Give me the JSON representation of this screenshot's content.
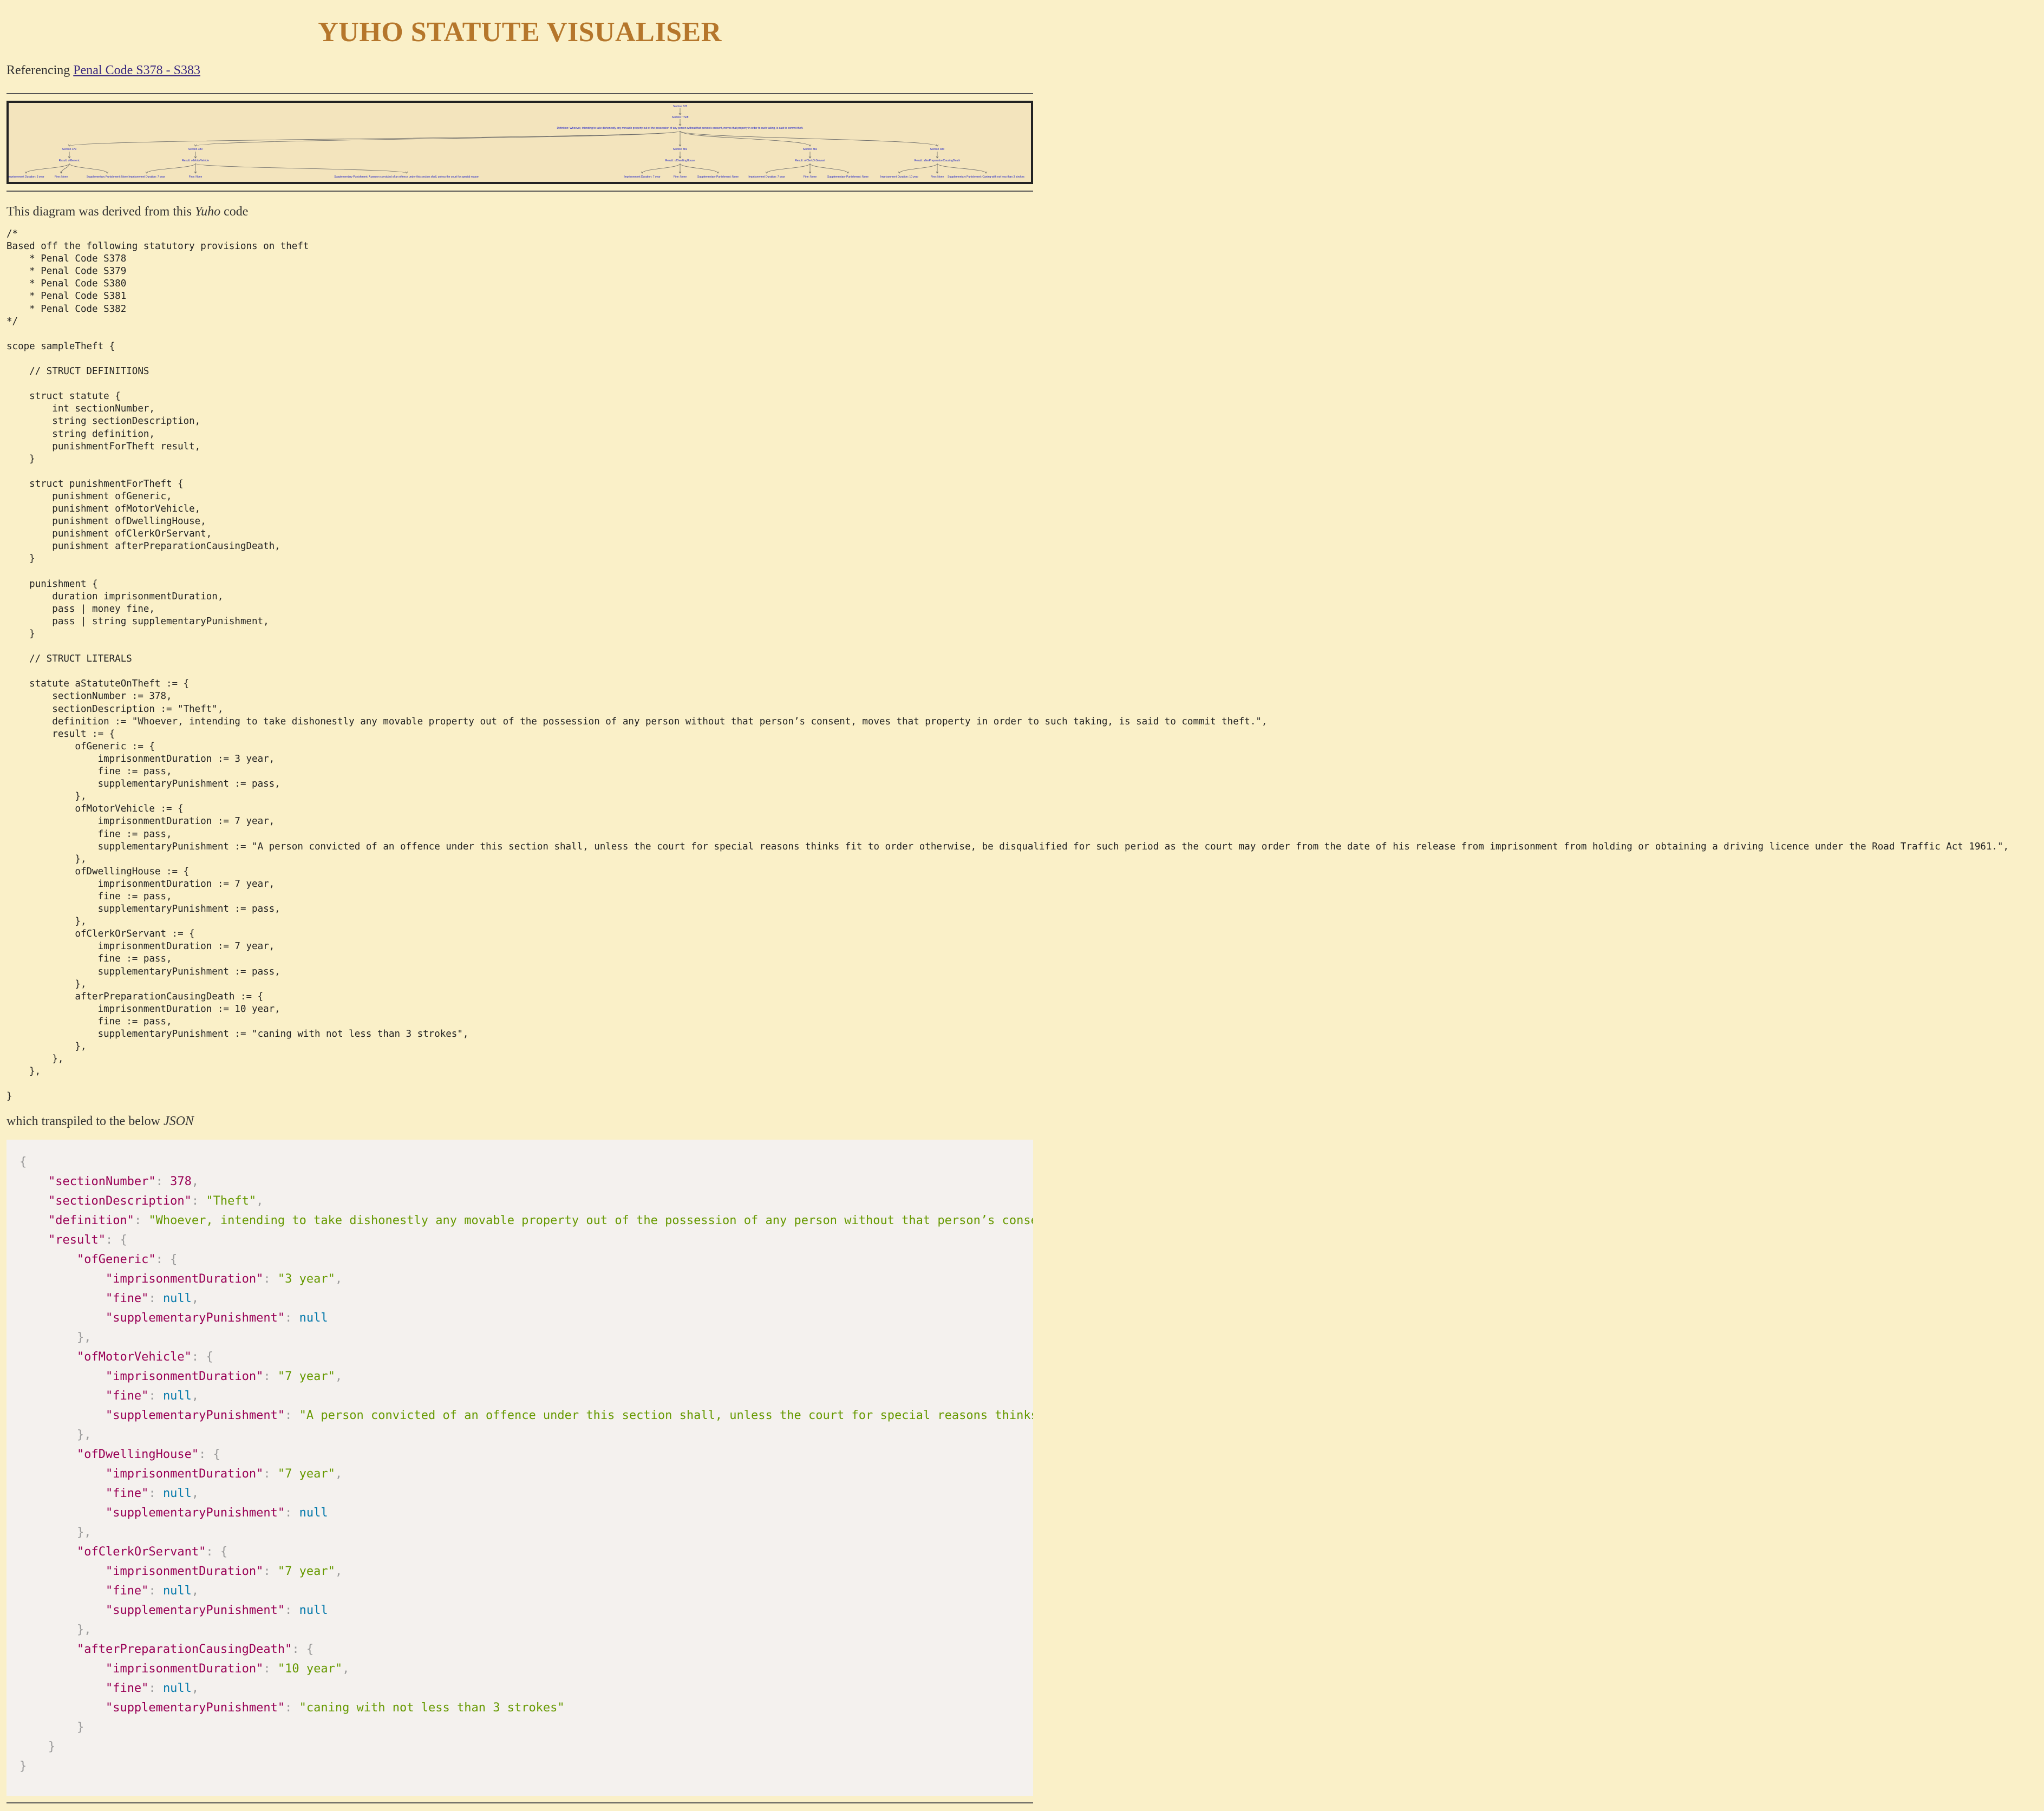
{
  "title": "YUHO STATUTE VISUALISER",
  "reference": {
    "prefix": "Referencing ",
    "link_text": "Penal Code S378 - S383"
  },
  "diagram": {
    "root": "Section 378",
    "description": "Section: Theft",
    "definition": "Definition: Whoever, intending to take dishonestly any movable property out of the possession of any person without that person's consent, moves that property in order to such taking, is said to commit theft.",
    "sections": [
      {
        "label": "Section 379",
        "group": "Result: ofGeneric",
        "leaves": [
          "Imprisonment Duration: 3 year",
          "Fine: None",
          "Supplementary Punishment: None"
        ]
      },
      {
        "label": "Section 380",
        "group": "Result: ofMotorVehicle",
        "leaves": [
          "Imprisonment Duration: 7 year",
          "Fine: None",
          "Supplementary Punishment: A person convicted of an offence under this section shall, unless the court for special reasons thinks fit to order otherwise, be disqualified for such period as the court may order from the date of his release from imprisonment from holding or obtaining a driving licence under the Road Traffic Act 1961."
        ]
      },
      {
        "label": "Section 381",
        "group": "Result: ofDwellingHouse",
        "leaves": [
          "Imprisonment Duration: 7 year",
          "Fine: None",
          "Supplementary Punishment: None"
        ]
      },
      {
        "label": "Section 382",
        "group": "Result: ofClerkOrServant",
        "leaves": [
          "Imprisonment Duration: 7 year",
          "Fine: None",
          "Supplementary Punishment: None"
        ]
      },
      {
        "label": "Section 383",
        "group": "Result: afterPreparationCausingDeath",
        "leaves": [
          "Imprisonment Duration: 10 year",
          "Fine: None",
          "Supplementary Punishment: Caning with not less than 3 strokes"
        ]
      }
    ]
  },
  "derived": {
    "prefix": "This diagram was derived from this ",
    "lang": "Yuho",
    "suffix": " code"
  },
  "yuho_code": "/*\nBased off the following statutory provisions on theft\n    * Penal Code S378\n    * Penal Code S379\n    * Penal Code S380\n    * Penal Code S381\n    * Penal Code S382\n*/\n\nscope sampleTheft {\n\n    // STRUCT DEFINITIONS\n\n    struct statute {\n        int sectionNumber,\n        string sectionDescription,\n        string definition,\n        punishmentForTheft result,\n    }\n\n    struct punishmentForTheft {\n        punishment ofGeneric,\n        punishment ofMotorVehicle,\n        punishment ofDwellingHouse,\n        punishment ofClerkOrServant,\n        punishment afterPreparationCausingDeath,\n    }\n\n    punishment {\n        duration imprisonmentDuration,\n        pass | money fine,\n        pass | string supplementaryPunishment,\n    }\n\n    // STRUCT LITERALS\n\n    statute aStatuteOnTheft := {\n        sectionNumber := 378,\n        sectionDescription := \"Theft\",\n        definition := \"Whoever, intending to take dishonestly any movable property out of the possession of any person without that person’s consent, moves that property in order to such taking, is said to commit theft.\",\n        result := {\n            ofGeneric := {\n                imprisonmentDuration := 3 year,\n                fine := pass,\n                supplementaryPunishment := pass,\n            },\n            ofMotorVehicle := {\n                imprisonmentDuration := 7 year,\n                fine := pass,\n                supplementaryPunishment := \"A person convicted of an offence under this section shall, unless the court for special reasons thinks fit to order otherwise, be disqualified for such period as the court may order from the date of his release from imprisonment from holding or obtaining a driving licence under the Road Traffic Act 1961.\",\n            },\n            ofDwellingHouse := {\n                imprisonmentDuration := 7 year,\n                fine := pass,\n                supplementaryPunishment := pass,\n            },\n            ofClerkOrServant := {\n                imprisonmentDuration := 7 year,\n                fine := pass,\n                supplementaryPunishment := pass,\n            },\n            afterPreparationCausingDeath := {\n                imprisonmentDuration := 10 year,\n                fine := pass,\n                supplementaryPunishment := \"caning with not less than 3 strokes\",\n            },\n        },\n    },\n\n}",
  "transpiled": {
    "prefix": "which transpiled to the below ",
    "lang": "JSON"
  },
  "json_output": {
    "sectionNumber": 378,
    "sectionDescription": "Theft",
    "definition": "Whoever, intending to take dishonestly any movable property out of the possession of any person without that person’s conse",
    "result": [
      {
        "key": "ofGeneric",
        "imprisonmentDuration": "3 year",
        "fine": "null",
        "supplementaryPunishment": "null"
      },
      {
        "key": "ofMotorVehicle",
        "imprisonmentDuration": "7 year",
        "fine": "null",
        "supplementaryPunishment": "A person convicted of an offence under this section shall, unless the court for special reasons thinks"
      },
      {
        "key": "ofDwellingHouse",
        "imprisonmentDuration": "7 year",
        "fine": "null",
        "supplementaryPunishment": "null"
      },
      {
        "key": "ofClerkOrServant",
        "imprisonmentDuration": "7 year",
        "fine": "null",
        "supplementaryPunishment": "null"
      },
      {
        "key": "afterPreparationCausingDeath",
        "imprisonmentDuration": "10 year",
        "fine": "null",
        "supplementaryPunishment": "caning with not less than 3 strokes"
      }
    ]
  },
  "colors": {
    "background": "#faf0c8",
    "title": "#b5762b",
    "link": "#3b2a80",
    "json_key": "#990055",
    "json_string": "#669900",
    "json_null": "#0077aa"
  }
}
